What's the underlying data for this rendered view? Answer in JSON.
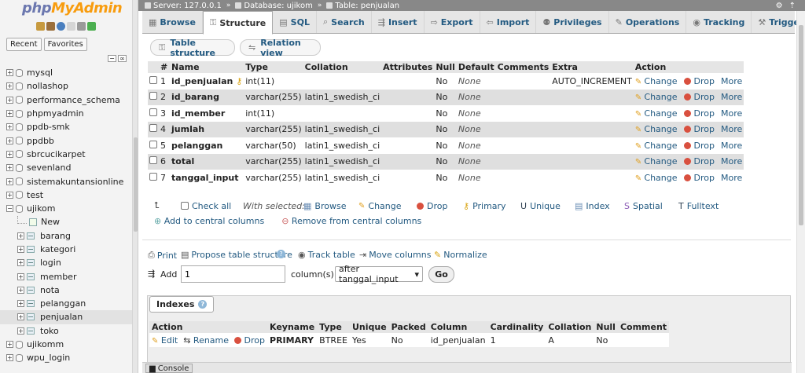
{
  "sidebar": {
    "logo_php": "php",
    "logo_myadmin": "MyAdmin",
    "recent_tab": "Recent",
    "favorites_tab": "Favorites",
    "databases": [
      {
        "name": "mysql",
        "expander": "+"
      },
      {
        "name": "nollashop",
        "expander": "+"
      },
      {
        "name": "performance_schema",
        "expander": "+"
      },
      {
        "name": "phpmyadmin",
        "expander": "+"
      },
      {
        "name": "ppdb-smk",
        "expander": "+"
      },
      {
        "name": "ppdbb",
        "expander": "+"
      },
      {
        "name": "sbrcucikarpet",
        "expander": "+"
      },
      {
        "name": "sevenland",
        "expander": "+"
      },
      {
        "name": "sistemakuntansionline",
        "expander": "+"
      },
      {
        "name": "test",
        "expander": "+"
      },
      {
        "name": "ujikom",
        "expander": "−"
      }
    ],
    "new_item": "New",
    "tables": [
      "barang",
      "kategori",
      "login",
      "member",
      "nota",
      "pelanggan",
      "penjualan",
      "toko"
    ],
    "databases_after": [
      {
        "name": "ujikomm",
        "expander": "+"
      },
      {
        "name": "wpu_login",
        "expander": "+"
      }
    ]
  },
  "breadcrumb": {
    "server": "Server: 127.0.0.1",
    "database": "Database: ujikom",
    "table": "Table: penjualan"
  },
  "tabs": [
    {
      "label": "Browse",
      "icon": "▦"
    },
    {
      "label": "Structure",
      "icon": "⚿",
      "active": true
    },
    {
      "label": "SQL",
      "icon": "▤"
    },
    {
      "label": "Search",
      "icon": "⌕"
    },
    {
      "label": "Insert",
      "icon": "⇶"
    },
    {
      "label": "Export",
      "icon": "⇨"
    },
    {
      "label": "Import",
      "icon": "⇦"
    },
    {
      "label": "Privileges",
      "icon": "⚉"
    },
    {
      "label": "Operations",
      "icon": "✎"
    },
    {
      "label": "Tracking",
      "icon": "◉"
    },
    {
      "label": "Triggers",
      "icon": "⚒"
    }
  ],
  "subtabs": {
    "table_structure": "Table structure",
    "relation_view": "Relation view"
  },
  "structure": {
    "headers": [
      "#",
      "Name",
      "Type",
      "Collation",
      "Attributes",
      "Null",
      "Default",
      "Comments",
      "Extra",
      "Action"
    ],
    "rows": [
      {
        "num": "1",
        "name": "id_penjualan",
        "type": "int(11)",
        "collation": "",
        "null": "No",
        "default": "None",
        "extra": "AUTO_INCREMENT",
        "primary": true
      },
      {
        "num": "2",
        "name": "id_barang",
        "type": "varchar(255)",
        "collation": "latin1_swedish_ci",
        "null": "No",
        "default": "None",
        "extra": ""
      },
      {
        "num": "3",
        "name": "id_member",
        "type": "int(11)",
        "collation": "",
        "null": "No",
        "default": "None",
        "extra": ""
      },
      {
        "num": "4",
        "name": "jumlah",
        "type": "varchar(255)",
        "collation": "latin1_swedish_ci",
        "null": "No",
        "default": "None",
        "extra": ""
      },
      {
        "num": "5",
        "name": "pelanggan",
        "type": "varchar(50)",
        "collation": "latin1_swedish_ci",
        "null": "No",
        "default": "None",
        "extra": ""
      },
      {
        "num": "6",
        "name": "total",
        "type": "varchar(255)",
        "collation": "latin1_swedish_ci",
        "null": "No",
        "default": "None",
        "extra": ""
      },
      {
        "num": "7",
        "name": "tanggal_input",
        "type": "varchar(255)",
        "collation": "latin1_swedish_ci",
        "null": "No",
        "default": "None",
        "extra": ""
      }
    ],
    "action_change": "Change",
    "action_drop": "Drop",
    "action_more": "More"
  },
  "bulk": {
    "check_all": "Check all",
    "with_selected": "With selected:",
    "browse": "Browse",
    "change": "Change",
    "drop": "Drop",
    "primary": "Primary",
    "unique": "Unique",
    "index": "Index",
    "spatial": "Spatial",
    "fulltext": "Fulltext",
    "add_central": "Add to central columns",
    "remove_central": "Remove from central columns"
  },
  "links": {
    "print": "Print",
    "propose": "Propose table structure",
    "track": "Track table",
    "move": "Move columns",
    "normalize": "Normalize"
  },
  "add_column": {
    "label": "Add",
    "value": "1",
    "suffix": "column(s)",
    "position": "after tanggal_input",
    "go": "Go"
  },
  "indexes": {
    "legend": "Indexes",
    "headers": [
      "Action",
      "Keyname",
      "Type",
      "Unique",
      "Packed",
      "Column",
      "Cardinality",
      "Collation",
      "Null",
      "Comment"
    ],
    "row": {
      "edit": "Edit",
      "rename": "Rename",
      "drop": "Drop",
      "keyname": "PRIMARY",
      "type": "BTREE",
      "unique": "Yes",
      "packed": "No",
      "column": "id_penjualan",
      "cardinality": "1",
      "collation": "A",
      "null": "No",
      "comment": ""
    }
  },
  "console": "Console"
}
